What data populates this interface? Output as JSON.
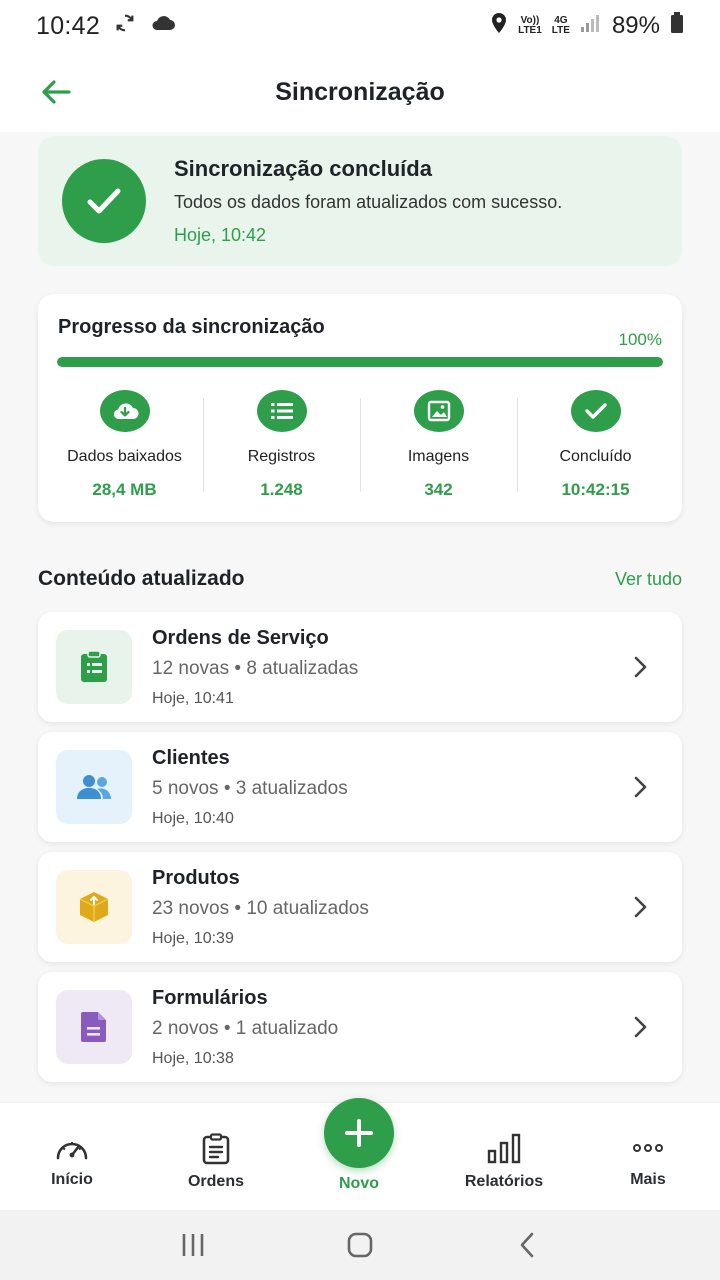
{
  "status_bar": {
    "time": "10:42",
    "volte": "Vo))",
    "lte1": "LTE1",
    "net": "4G",
    "lte2": "LTE",
    "battery": "89%"
  },
  "header": {
    "title": "Sincronização"
  },
  "banner": {
    "title": "Sincronização concluída",
    "subtitle": "Todos os dados foram atualizados com sucesso.",
    "time": "Hoje, 10:42",
    "color": "#2e9e4a"
  },
  "progress": {
    "title": "Progresso da sincronização",
    "percent_label": "100%",
    "percent": 100,
    "stats": [
      {
        "icon": "cloud-download-icon",
        "label": "Dados baixados",
        "value": "28,4 MB"
      },
      {
        "icon": "list-icon",
        "label": "Registros",
        "value": "1.248"
      },
      {
        "icon": "image-icon",
        "label": "Imagens",
        "value": "342"
      },
      {
        "icon": "check-icon",
        "label": "Concluído",
        "value": "10:42:15"
      }
    ]
  },
  "content": {
    "title": "Conteúdo atualizado",
    "see_all": "Ver tudo",
    "items": [
      {
        "icon": "clipboard-icon",
        "title": "Ordens de Serviço",
        "subtitle": "12 novas • 8 atualizadas",
        "time": "Hoje, 10:41",
        "bg": "#e8f4eb",
        "color": "#2e9e4a"
      },
      {
        "icon": "users-icon",
        "title": "Clientes",
        "subtitle": "5 novos • 3 atualizados",
        "time": "Hoje, 10:40",
        "bg": "#e6f2fb",
        "color": "#3d8fd1"
      },
      {
        "icon": "box-icon",
        "title": "Produtos",
        "subtitle": "23 novos • 10 atualizados",
        "time": "Hoje, 10:39",
        "bg": "#fcf4de",
        "color": "#e0a91a"
      },
      {
        "icon": "document-icon",
        "title": "Formulários",
        "subtitle": "2 novos • 1 atualizado",
        "time": "Hoje, 10:38",
        "bg": "#efe9f6",
        "color": "#8a5bbf"
      }
    ]
  },
  "bottom_nav": {
    "items": [
      {
        "icon": "gauge-icon",
        "label": "Início"
      },
      {
        "icon": "clipboard-list-icon",
        "label": "Ordens"
      },
      {
        "icon": "plus-icon",
        "label": "Novo"
      },
      {
        "icon": "bar-chart-icon",
        "label": "Relatórios"
      },
      {
        "icon": "more-icon",
        "label": "Mais"
      }
    ]
  }
}
